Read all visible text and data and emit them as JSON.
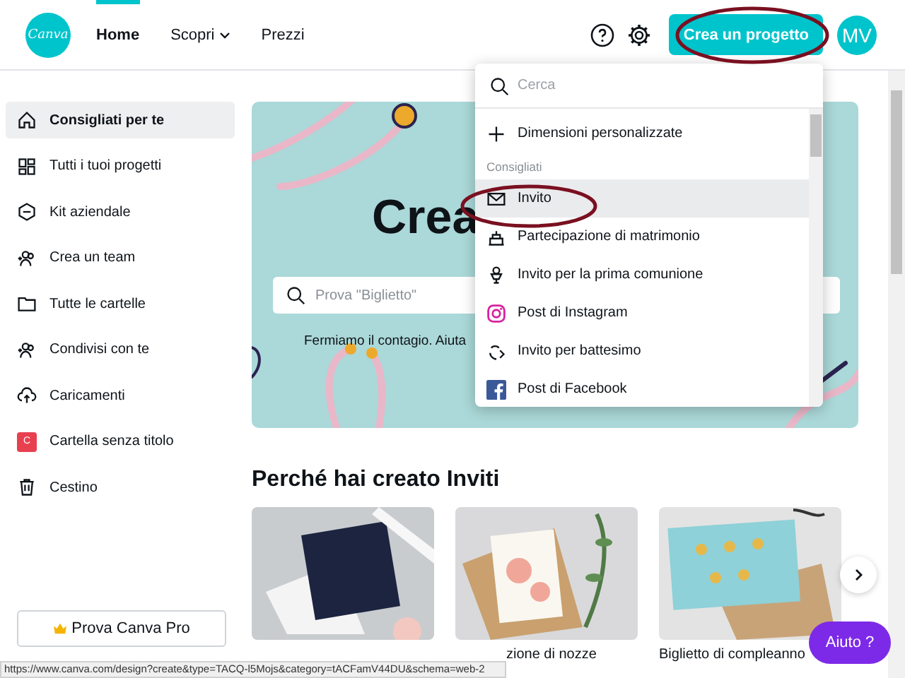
{
  "header": {
    "logo": "Canva",
    "nav": [
      {
        "label": "Home",
        "selected": true,
        "caret": false
      },
      {
        "label": "Scopri",
        "selected": false,
        "caret": true
      },
      {
        "label": "Prezzi",
        "selected": false,
        "caret": false
      }
    ],
    "create_button": "Crea un progetto",
    "avatar": "MV"
  },
  "sidebar": {
    "items": [
      {
        "kind": "home",
        "label": "Consigliati per te",
        "selected": true
      },
      {
        "kind": "grid",
        "label": "Tutti i tuoi progetti",
        "selected": false
      },
      {
        "kind": "brand",
        "label": "Kit aziendale",
        "selected": false
      },
      {
        "kind": "team",
        "label": "Crea un team",
        "selected": false
      },
      {
        "kind": "folder",
        "label": "Tutte le cartelle",
        "selected": false
      },
      {
        "kind": "team",
        "label": "Condivisi con te",
        "selected": false
      },
      {
        "kind": "upload",
        "label": "Caricamenti",
        "selected": false
      },
      {
        "kind": "badge",
        "badge": "C",
        "color": "#e8404f",
        "label": "Cartella senza titolo",
        "selected": false
      },
      {
        "kind": "trash",
        "label": "Cestino",
        "selected": false
      }
    ],
    "pro_button": "Prova Canva Pro"
  },
  "hero": {
    "title": "Crea",
    "search": {
      "placeholder": "Prova \"Biglietto\""
    },
    "caption": "Fermiamo il contagio. Aiuta"
  },
  "section": {
    "title": "Perché hai creato Inviti",
    "cards": [
      {
        "kind": "picture"
      },
      {
        "kind": "picture",
        "caption": "zione di nozze"
      },
      {
        "kind": "picture",
        "caption": "Biglietto di compleanno"
      }
    ]
  },
  "dropdown": {
    "search": {
      "placeholder": "Cerca"
    },
    "custom": "Dimensioni personalizzate",
    "group": "Consigliati",
    "items": [
      {
        "kind": "invite",
        "label": "Invito",
        "selected": true
      },
      {
        "kind": "wedding",
        "label": "Partecipazione di matrimonio",
        "selected": false
      },
      {
        "kind": "communion",
        "label": "Invito per la prima comunione",
        "selected": false
      },
      {
        "kind": "instagram",
        "label": "Post di Instagram",
        "selected": false
      },
      {
        "kind": "baptism",
        "label": "Invito per battesimo",
        "selected": false
      },
      {
        "kind": "facebook",
        "label": "Post di Facebook",
        "selected": false
      }
    ]
  },
  "help_button": "Aiuto ?",
  "status_bar": "https://www.canva.com/design?create&type=TACQ-l5Mojs&category=tACFamV44DU&schema=web-2"
}
